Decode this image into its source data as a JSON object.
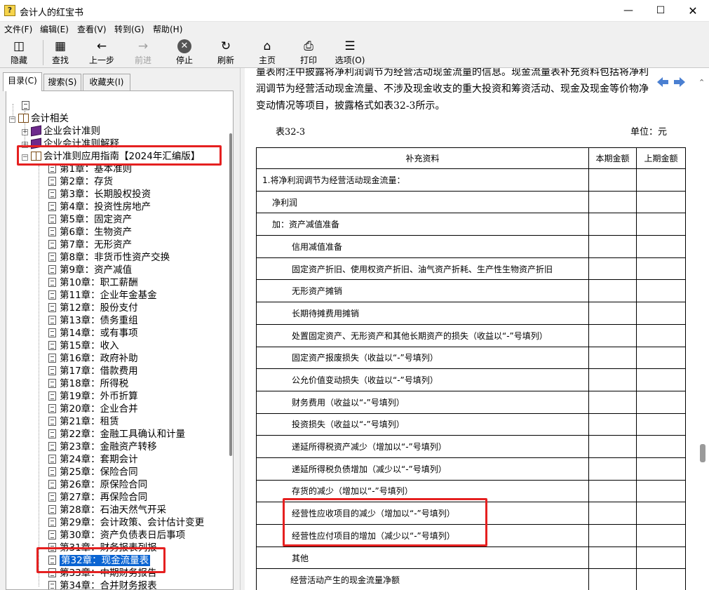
{
  "window": {
    "title": "会计人的红宝书"
  },
  "menu": [
    "文件(F)",
    "编辑(E)",
    "查看(V)",
    "转到(G)",
    "帮助(H)"
  ],
  "toolbar": {
    "hide": "隐藏",
    "find": "查找",
    "back": "上一步",
    "forward": "前进",
    "stop": "停止",
    "refresh": "刷新",
    "home": "主页",
    "print": "打印",
    "options": "选项(O)"
  },
  "tabs": [
    "目录(C)",
    "搜索(S)",
    "收藏夹(I)"
  ],
  "tree": {
    "root": "会计相关",
    "books": [
      "企业会计准则",
      "企业会计准则解释"
    ],
    "guide": "会计准则应用指南【2024年汇编版】",
    "chapters": [
      "第1章：基本准则",
      "第2章：存货",
      "第3章：长期股权投资",
      "第4章：投资性房地产",
      "第5章：固定资产",
      "第6章：生物资产",
      "第7章：无形资产",
      "第8章：非货币性资产交换",
      "第9章：资产减值",
      "第10章：职工薪酬",
      "第11章：企业年金基金",
      "第12章：股份支付",
      "第13章：债务重组",
      "第14章：或有事项",
      "第15章：收入",
      "第16章：政府补助",
      "第17章：借款费用",
      "第18章：所得税",
      "第19章：外币折算",
      "第20章：企业合并",
      "第21章：租赁",
      "第22章：金融工具确认和计量",
      "第23章：金融资产转移",
      "第24章：套期会计",
      "第25章：保险合同",
      "第26章：原保险合同",
      "第27章：再保险合同",
      "第28章：石油天然气开采",
      "第29章：会计政策、会计估计变更",
      "第30章：资产负债表日后事项",
      "第31章：财务报表列报",
      "第32章：现金流量表",
      "第33章：中期财务报告",
      "第34章：合并财务报表"
    ]
  },
  "content": {
    "lines": [
      "量表附注中披露将净利润调节为经营活动现金流量的信息。现金流量表补充资料包括将净利",
      "润调节为经营活动现金流量、不涉及现金收支的重大投资和筹资活动、现金及现金等价物净",
      "变动情况等项目，披露格式如表32-3所示。"
    ],
    "caption": "表32-3",
    "unit": "单位：元",
    "table": {
      "headers": [
        "补充资料",
        "本期金额",
        "上期金额"
      ],
      "rows": [
        "1.将净利润调节为经营活动现金流量：",
        "净利润",
        "加：资产减值准备",
        "信用减值准备",
        "固定资产折旧、使用权资产折旧、油气资产折耗、生产性生物资产折旧",
        "无形资产摊销",
        "长期待摊费用摊销",
        "处置固定资产、无形资产和其他长期资产的损失（收益以“-”号填列）",
        "固定资产报废损失（收益以“-”号填列）",
        "公允价值变动损失（收益以“-”号填列）",
        "财务费用（收益以“-”号填列）",
        "投资损失（收益以“-”号填列）",
        "递延所得税资产减少（增加以“-”号填列）",
        "递延所得税负债增加（减少以“-”号填列）",
        "存货的减少（增加以“-”号填列）",
        "经营性应收项目的减少（增加以“-”号填列）",
        "经营性应付项目的增加（减少以“-”号填列）",
        "其他",
        "经营活动产生的现金流量净额"
      ]
    }
  }
}
